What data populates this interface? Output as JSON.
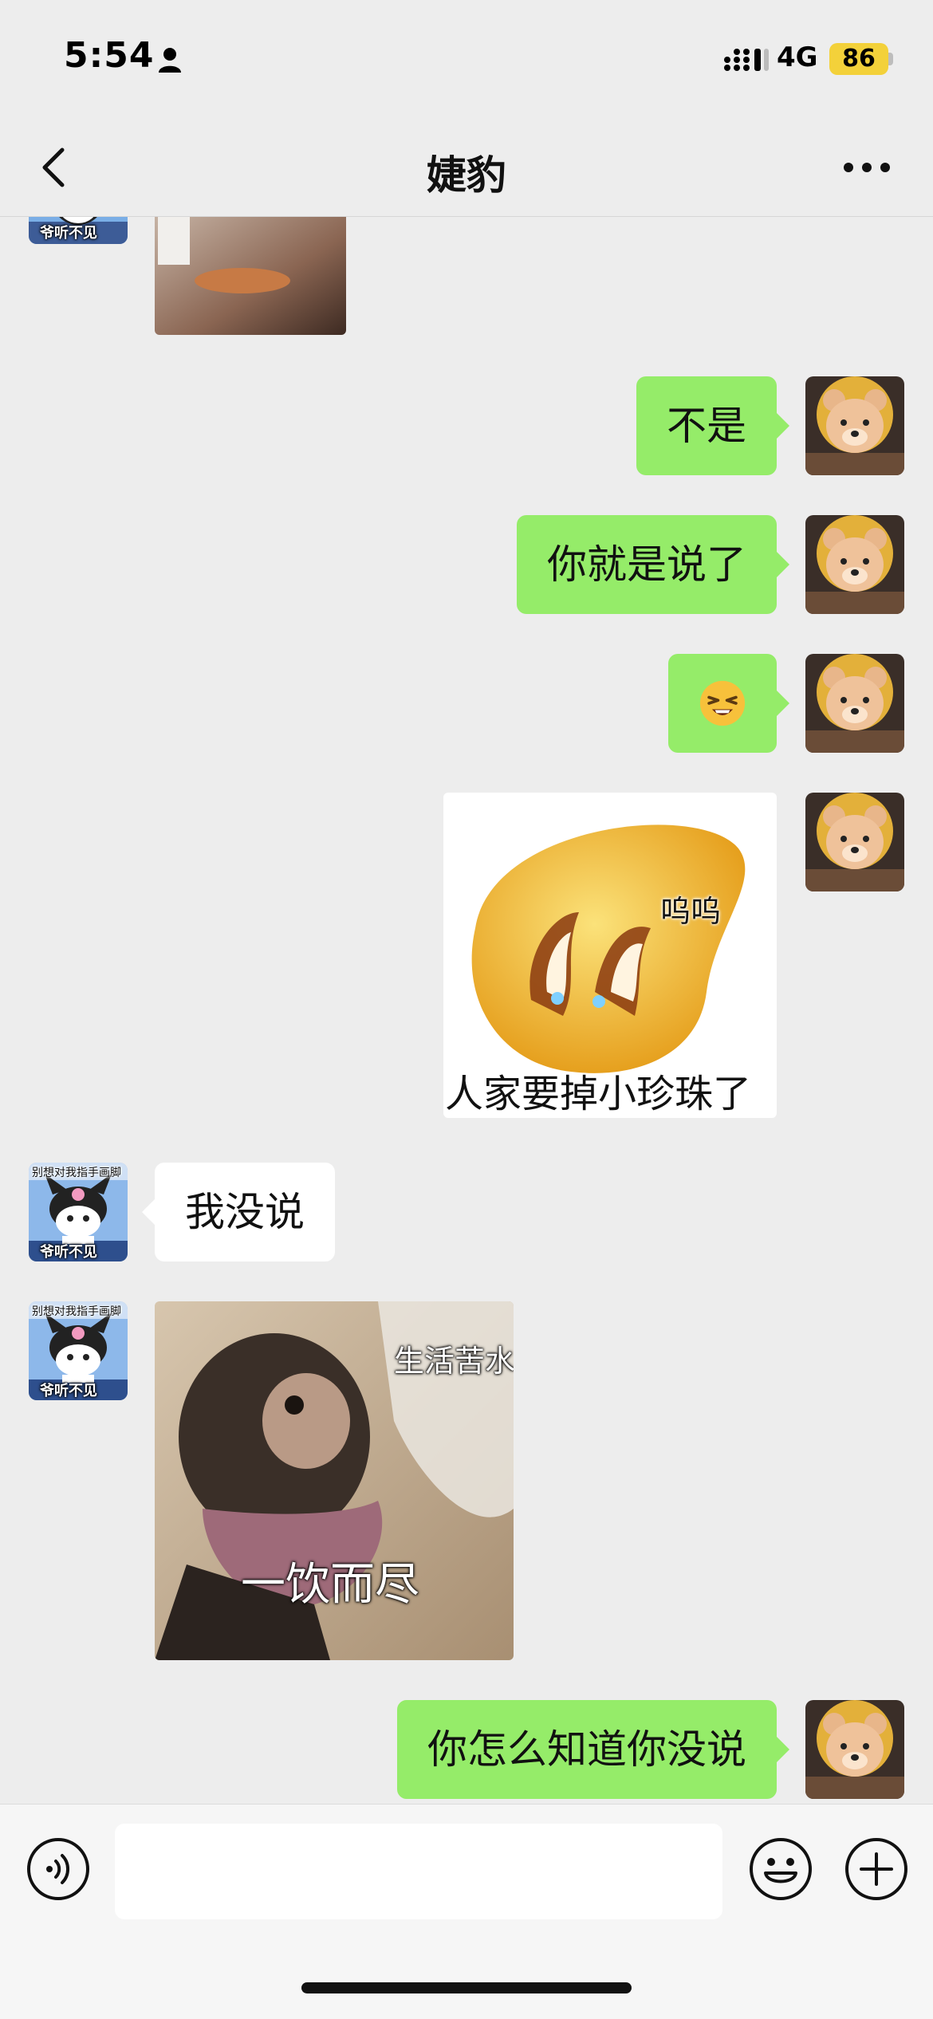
{
  "status_bar": {
    "time": "5:54",
    "network": "4G",
    "battery": "86",
    "person_icon": "person-icon",
    "signal_icon": "signal-bars-icon"
  },
  "nav": {
    "title": "婕豹",
    "back_icon": "chevron-left-icon",
    "more_icon": "more-dots-icon"
  },
  "contact_avatar": {
    "caption_top": "别想对我指手画脚",
    "caption_bottom": "爷听不见"
  },
  "messages": [
    {
      "from": "contact",
      "type": "image",
      "note": "partially scrolled"
    },
    {
      "from": "me",
      "type": "text",
      "text": "不是"
    },
    {
      "from": "me",
      "type": "text",
      "text": "你就是说了"
    },
    {
      "from": "me",
      "type": "emoji",
      "text": "😫"
    },
    {
      "from": "me",
      "type": "sticker",
      "text_top": "呜呜",
      "text_bottom": "人家要掉小珍珠了"
    },
    {
      "from": "contact",
      "type": "text",
      "text": "我没说"
    },
    {
      "from": "contact",
      "type": "sticker",
      "text_top": "生活苦水",
      "text_bottom": "一饮而尽"
    },
    {
      "from": "me",
      "type": "text",
      "text": "你怎么知道你没说"
    }
  ],
  "input_bar": {
    "value": "",
    "voice_icon": "voice-icon",
    "emoji_icon": "emoji-icon",
    "plus_icon": "plus-icon"
  },
  "colors": {
    "background": "#ededed",
    "outgoing_bubble": "#95ec69",
    "incoming_bubble": "#ffffff",
    "battery": "#f3d13a"
  }
}
